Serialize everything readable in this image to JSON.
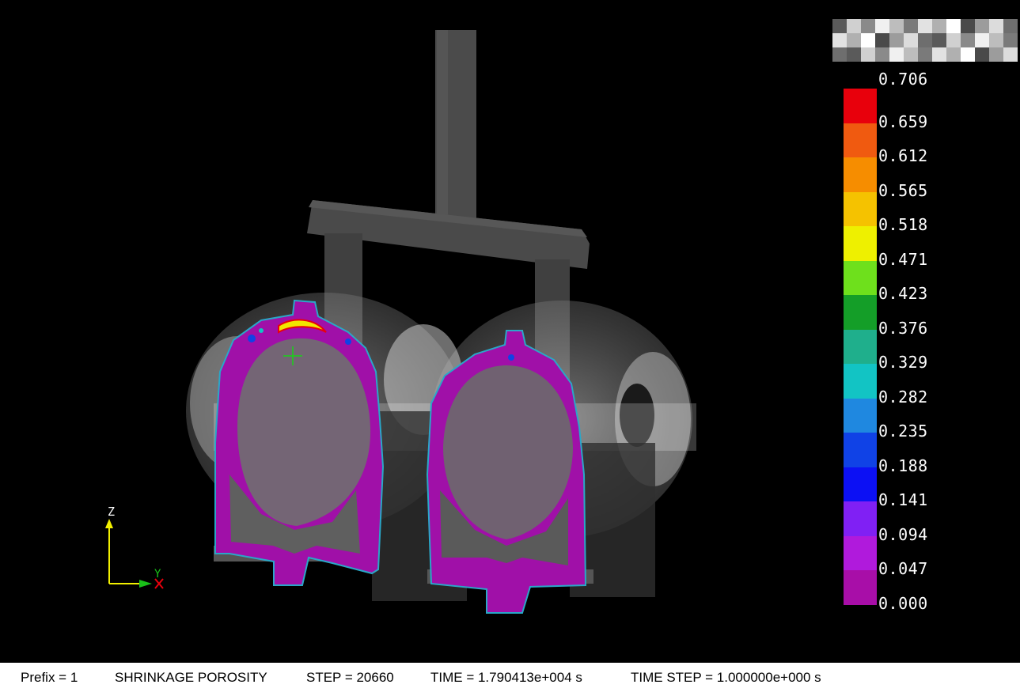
{
  "legend": {
    "max_label": "0.706",
    "entries": [
      {
        "label": "0.659",
        "color": "#e8000c"
      },
      {
        "label": "0.612",
        "color": "#f05a10"
      },
      {
        "label": "0.565",
        "color": "#f68d00"
      },
      {
        "label": "0.518",
        "color": "#f5c200"
      },
      {
        "label": "0.471",
        "color": "#eef000"
      },
      {
        "label": "0.423",
        "color": "#6ee01c"
      },
      {
        "label": "0.376",
        "color": "#149e28"
      },
      {
        "label": "0.329",
        "color": "#1faf8c"
      },
      {
        "label": "0.282",
        "color": "#12c4c4"
      },
      {
        "label": "0.235",
        "color": "#1f88e0"
      },
      {
        "label": "0.188",
        "color": "#1042e6"
      },
      {
        "label": "0.141",
        "color": "#0c10f4"
      },
      {
        "label": "0.094",
        "color": "#8020f4"
      },
      {
        "label": "0.047",
        "color": "#b01adc"
      },
      {
        "label": "0.000",
        "color": "#a80ea8"
      }
    ]
  },
  "axes": {
    "z_label": "Z",
    "y_label": "Y",
    "x_label": "X"
  },
  "status": {
    "prefix": "Prefix = 1",
    "result": "SHRINKAGE POROSITY",
    "step": "STEP = 20660",
    "time": "TIME = 1.790413e+004 s",
    "time_step": "TIME STEP = 1.000000e+000 s"
  },
  "colors": {
    "casting_section": "#a010a8",
    "mold": "#4a4a4a",
    "background": "#000000"
  }
}
